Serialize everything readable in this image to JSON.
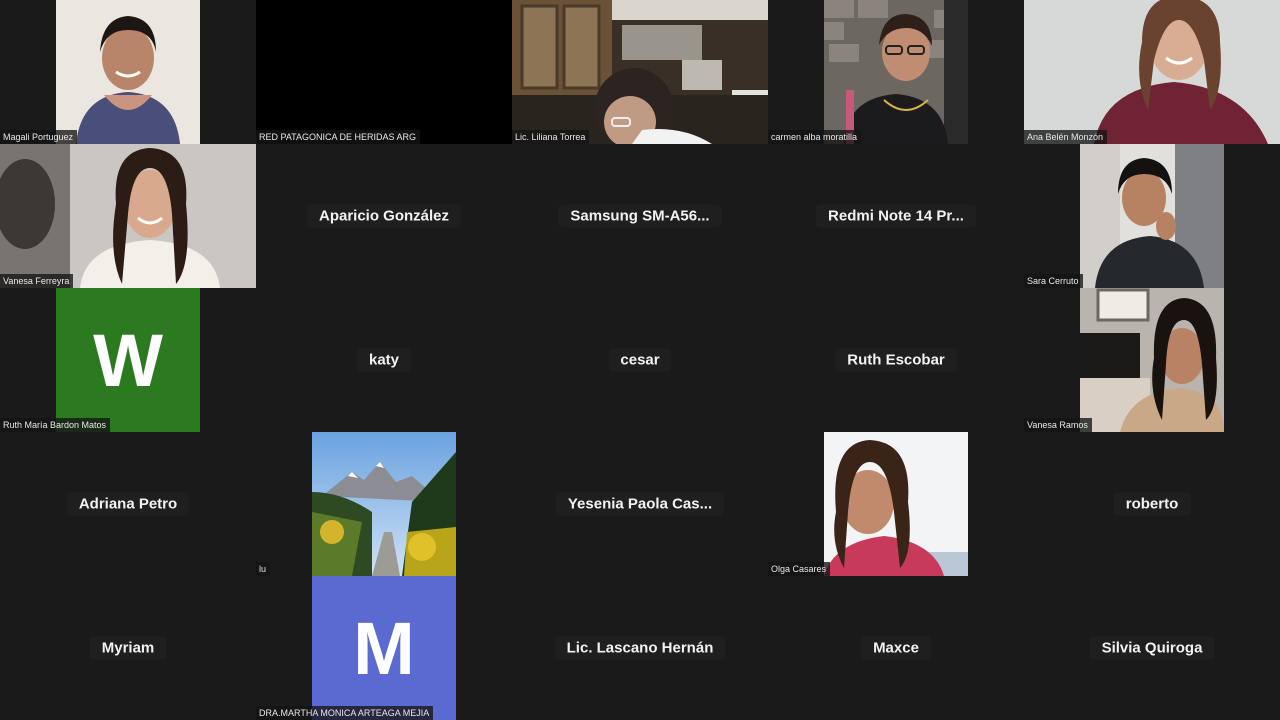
{
  "participants": [
    {
      "name": "Magali Portuguez",
      "type": "video"
    },
    {
      "name": "RED PATAGONICA DE HERIDAS ARG",
      "type": "video-off"
    },
    {
      "name": "Lic. Liliana Torrea",
      "type": "video"
    },
    {
      "name": "carmen alba moratilla",
      "type": "video"
    },
    {
      "name": "Ana Belén Monzón",
      "type": "video"
    },
    {
      "name": "Vanesa Ferreyra",
      "type": "video"
    },
    {
      "name": "Aparicio González",
      "type": "name-only"
    },
    {
      "name": "Samsung  SM-A56...",
      "type": "name-only"
    },
    {
      "name": "Redmi Note 14 Pr...",
      "type": "name-only"
    },
    {
      "name": "Sara Cerruto",
      "type": "video"
    },
    {
      "name": "Ruth María Bardon Matos",
      "type": "avatar",
      "initial": "W",
      "color": "#2b7a1f"
    },
    {
      "name": "katy",
      "type": "name-only"
    },
    {
      "name": "cesar",
      "type": "name-only"
    },
    {
      "name": "Ruth Escobar",
      "type": "name-only"
    },
    {
      "name": "Vanesa Ramos",
      "type": "video"
    },
    {
      "name": "Adriana Petro",
      "type": "name-only"
    },
    {
      "name": "lu",
      "type": "profile-image"
    },
    {
      "name": "Yesenia  Paola Cas...",
      "type": "name-only"
    },
    {
      "name": "Olga Casares",
      "type": "profile-image"
    },
    {
      "name": "roberto",
      "type": "name-only"
    },
    {
      "name": "Myriam",
      "type": "name-only"
    },
    {
      "name": "DRA.MARTHA MONICA ARTEAGA MEJIA",
      "type": "avatar",
      "initial": "M",
      "color": "#5a6ad1"
    },
    {
      "name": "Lic. Lascano Hernán",
      "type": "name-only"
    },
    {
      "name": "Maxce",
      "type": "name-only"
    },
    {
      "name": "Silvia Quiroga",
      "type": "name-only"
    }
  ],
  "colors": {
    "background": "#1a1a1a",
    "avatar_w": "#2b7a1f",
    "avatar_m": "#5a6ad1"
  }
}
